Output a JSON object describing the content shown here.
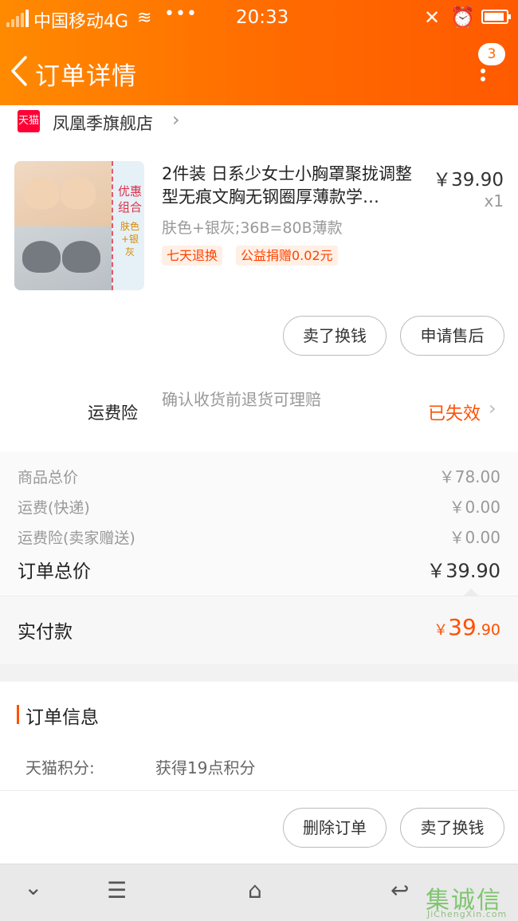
{
  "status_bar": {
    "carrier": "中国移动4G",
    "dots": "•••",
    "time": "20:33"
  },
  "header": {
    "title": "订单详情",
    "badge_count": "3"
  },
  "shop": {
    "logo_text": "天猫",
    "name": "凤凰季旗舰店"
  },
  "product": {
    "title": "2件装 日系少女士小胸罩聚拢调整型无痕文胸无钢圈厚薄款学…",
    "price": "￥39.90",
    "qty": "x1",
    "sku": "肤色+银灰;36B=80B薄款",
    "image_text_1": "优惠组合",
    "image_text_2": "肤色+银灰",
    "tags": [
      "七天退换",
      "公益捐赠0.02元"
    ]
  },
  "actions": {
    "sell_label": "卖了换钱",
    "after_sale_label": "申请售后"
  },
  "insurance": {
    "label": "运费险",
    "description": "确认收货前退货可理赔",
    "status": "已失效"
  },
  "summary": {
    "rows": [
      {
        "label": "商品总价",
        "value": "￥78.00"
      },
      {
        "label": "运费(快递)",
        "value": "￥0.00"
      },
      {
        "label": "运费险(卖家赠送)",
        "value": "￥0.00"
      }
    ],
    "total_label": "订单总价",
    "total_value": "￥39.90"
  },
  "paid": {
    "label": "实付款",
    "currency": "￥",
    "integer": "39",
    "decimal": ".90"
  },
  "order_info": {
    "title": "订单信息",
    "points_key": "天猫积分:",
    "points_value": "获得19点积分"
  },
  "bottom_actions": {
    "delete_label": "删除订单",
    "sell_label": "卖了换钱"
  },
  "nav": {
    "down": "⌄",
    "menu": "☰",
    "home": "⌂",
    "back": "↩"
  },
  "watermark": {
    "glyphs": "集诚信",
    "sub": "JiChengXin.com"
  },
  "colors": {
    "header_gradient": [
      "#ff8a00",
      "#ff5a00"
    ],
    "accent": "#ff5000",
    "tmall_red": "#ff0036"
  }
}
